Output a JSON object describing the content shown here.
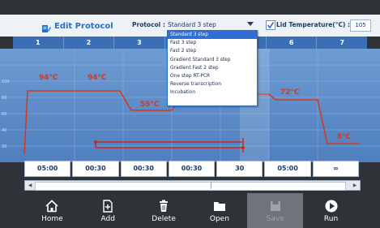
{
  "header": {
    "title": "Edit Protocol",
    "protocol_label": "Protocol :",
    "protocol_value": "Standard 3 step",
    "lid_label": "Lid Temperature(°C) :",
    "lid_value": "105",
    "lid_checked": true
  },
  "steps": [
    "1",
    "2",
    "3",
    "4",
    "5",
    "6",
    "7"
  ],
  "temperatures": {
    "t1": "94℃",
    "t2": "94℃",
    "t3": "55℃",
    "t6": "72℃",
    "t7": "8℃"
  },
  "times": [
    "05:00",
    "00:30",
    "00:30",
    "00:30",
    "30",
    "05:00",
    "∞"
  ],
  "protocol_options": [
    "Standard 3 step",
    "Fast 3 step",
    "Fast 2 step",
    "Gradient Standard 3 step",
    "Gradient Fast 2 step",
    "One step RT-PCR",
    "Reverse transcription",
    "Incubation"
  ],
  "selected_option_index": 0,
  "toolbar": {
    "home": "Home",
    "add": "Add",
    "delete": "Delete",
    "open": "Open",
    "save": "Save",
    "run": "Run"
  },
  "colors": {
    "accent": "#2f6fd4",
    "step_bar": "#3a6fb5",
    "temperature_line": "#d23b1e",
    "loop_marker": "#c8281b",
    "chart_bg": "#5b8cc8"
  },
  "icons": {
    "title": "edit-protocol-icon",
    "home": "home-icon",
    "add": "add-file-icon",
    "delete": "trash-icon",
    "open": "folder-icon",
    "save": "save-icon",
    "run": "play-icon"
  }
}
